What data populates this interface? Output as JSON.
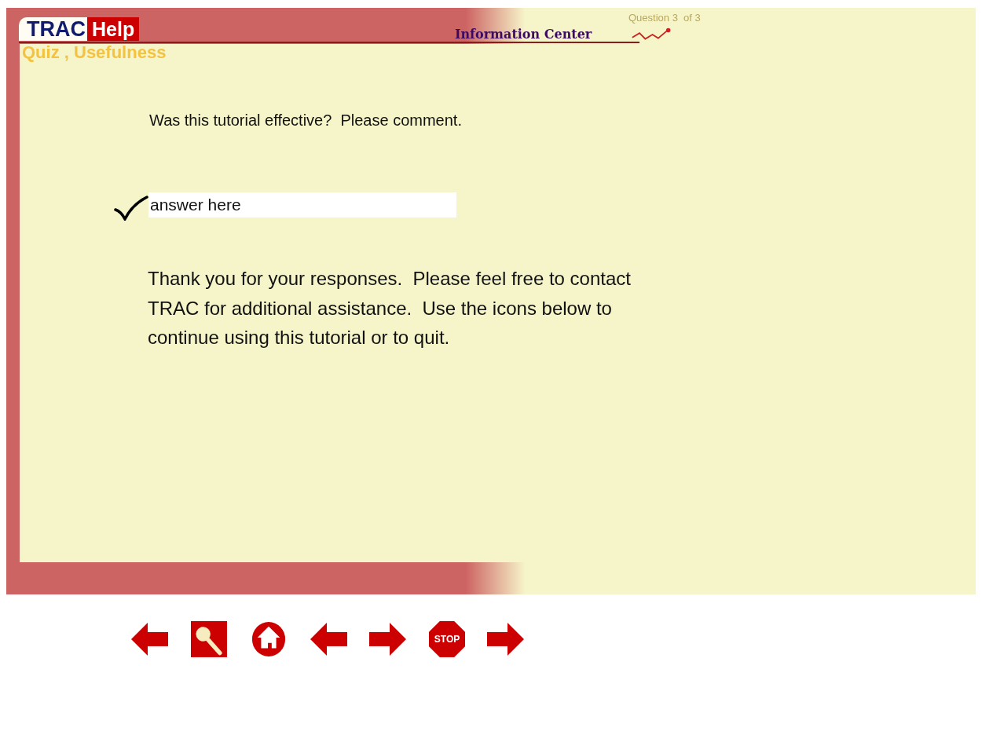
{
  "header": {
    "logo": {
      "left": "TRAC",
      "right": "Help"
    },
    "section": "Information Center",
    "progress": "Question 3  of 3"
  },
  "page_title": "Quiz , Usefulness",
  "question": "Was this tutorial effective?  Please comment.",
  "answer": {
    "value": "answer here",
    "checked": true
  },
  "message": "Thank you for your responses.  Please feel free to contact TRAC for additional assistance.  Use the icons below to continue using this tutorial or to quit.",
  "nav_buttons": [
    {
      "kind": "back"
    },
    {
      "kind": "search"
    },
    {
      "kind": "home"
    },
    {
      "kind": "back"
    },
    {
      "kind": "forward"
    },
    {
      "kind": "stop",
      "label": "STOP"
    },
    {
      "kind": "forward"
    }
  ]
}
